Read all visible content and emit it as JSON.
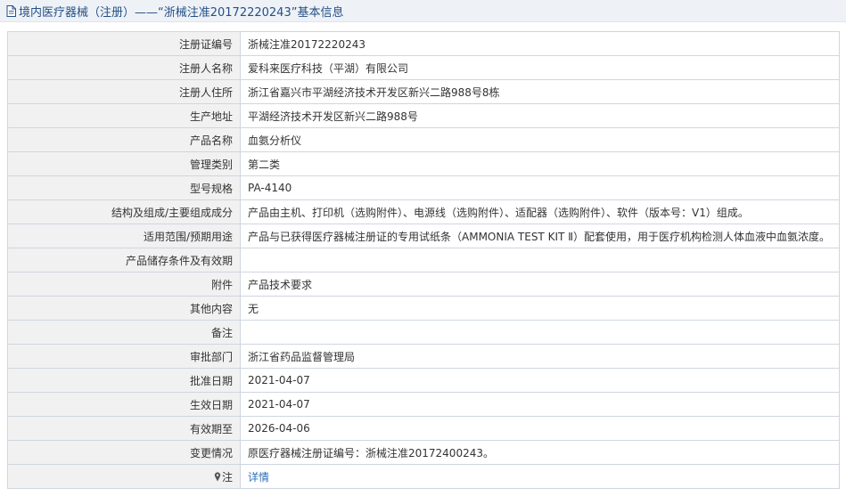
{
  "header": {
    "title": "境内医疗器械（注册）——“浙械注准20172220243”基本信息"
  },
  "rows": [
    {
      "label": "注册证编号",
      "value": "浙械注准20172220243"
    },
    {
      "label": "注册人名称",
      "value": "爱科来医疗科技（平湖）有限公司"
    },
    {
      "label": "注册人住所",
      "value": "浙江省嘉兴市平湖经济技术开发区新兴二路988号8栋"
    },
    {
      "label": "生产地址",
      "value": "平湖经济技术开发区新兴二路988号"
    },
    {
      "label": "产品名称",
      "value": "血氨分析仪"
    },
    {
      "label": "管理类别",
      "value": "第二类"
    },
    {
      "label": "型号规格",
      "value": "PA-4140"
    },
    {
      "label": "结构及组成/主要组成成分",
      "value": "产品由主机、打印机（选购附件）、电源线（选购附件）、适配器（选购附件）、软件（版本号：V1）组成。"
    },
    {
      "label": "适用范围/预期用途",
      "value": "产品与已获得医疗器械注册证的专用试纸条（AMMONIA TEST KIT Ⅱ）配套使用，用于医疗机构检测人体血液中血氨浓度。"
    },
    {
      "label": "产品储存条件及有效期",
      "value": ""
    },
    {
      "label": "附件",
      "value": "产品技术要求"
    },
    {
      "label": "其他内容",
      "value": "无"
    },
    {
      "label": "备注",
      "value": ""
    },
    {
      "label": "审批部门",
      "value": "浙江省药品监督管理局"
    },
    {
      "label": "批准日期",
      "value": "2021-04-07"
    },
    {
      "label": "生效日期",
      "value": "2021-04-07"
    },
    {
      "label": "有效期至",
      "value": "2026-04-06"
    },
    {
      "label": "变更情况",
      "value": "原医疗器械注册证编号：浙械注准20172400243。"
    }
  ],
  "note_row": {
    "label": "注",
    "link_text": "详情",
    "icon": "pin-icon"
  },
  "colors": {
    "title_text": "#244f88",
    "title_bg": "#eef2f6",
    "label_bg": "#f1f1f1",
    "border": "#cfd6e0",
    "link": "#2e6fb8"
  }
}
